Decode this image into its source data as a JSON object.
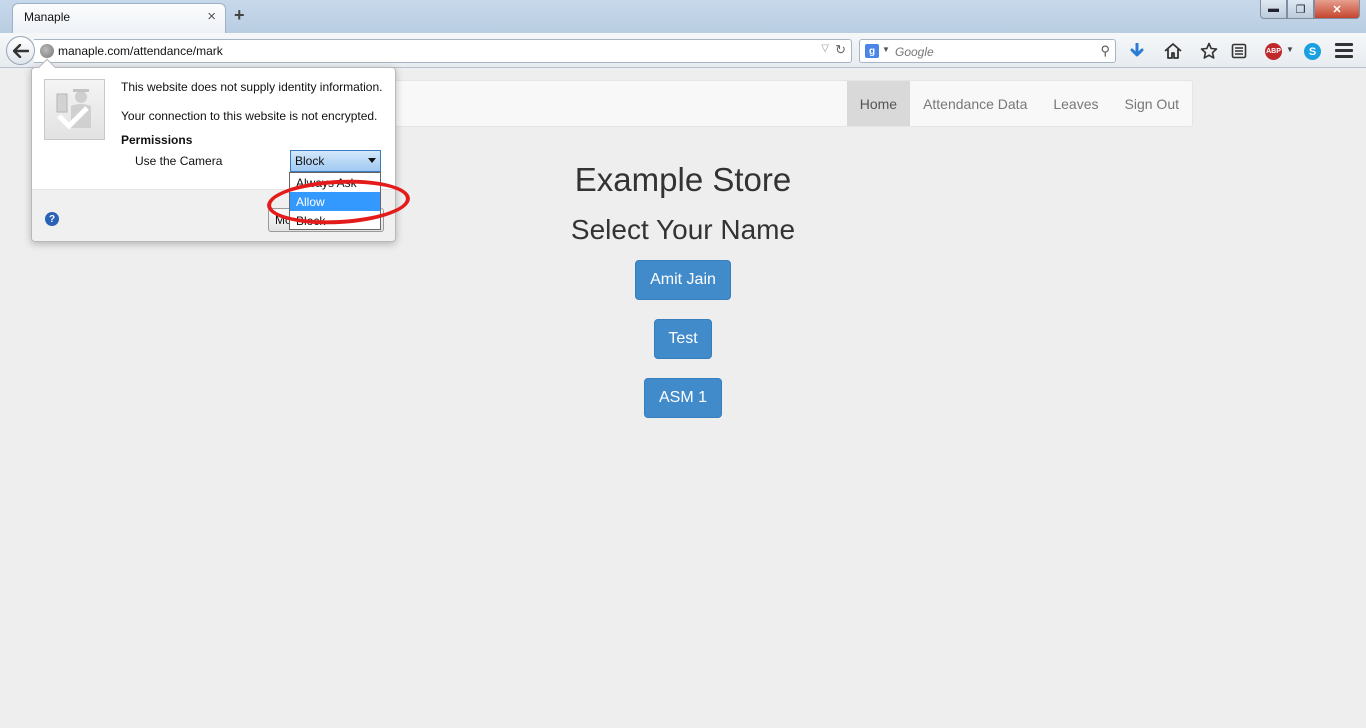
{
  "browser": {
    "tab_title": "Manaple",
    "tab_close": "×",
    "new_tab": "+",
    "url": "manaple.com/attendance/mark",
    "search_placeholder": "Google",
    "search_engine_letter": "g",
    "window_minimize": "▬",
    "window_restore": "❐",
    "window_close": "✕",
    "toolbar_icons": [
      "back-arrow-icon",
      "globe-icon",
      "url-dropdown-icon",
      "reload-icon",
      "google-icon",
      "search-icon",
      "download-icon",
      "home-icon",
      "bookmark-star-icon",
      "bookmarks-list-icon",
      "adblock-plus-icon",
      "skype-icon",
      "hamburger-menu-icon"
    ],
    "abp_label": "ABP",
    "skype_label": "S"
  },
  "site": {
    "nav": [
      {
        "label": "Home",
        "active": true
      },
      {
        "label": "Attendance Data",
        "active": false
      },
      {
        "label": "Leaves",
        "active": false
      },
      {
        "label": "Sign Out",
        "active": false
      }
    ],
    "store_title": "Example Store",
    "select_title": "Select Your Name",
    "names": [
      "Amit Jain",
      "Test",
      "ASM 1"
    ]
  },
  "identity_popup": {
    "line1": "This website does not supply identity information.",
    "line2": "Your connection to this website is not encrypted.",
    "permissions_heading": "Permissions",
    "permission_label": "Use the Camera",
    "permission_value": "Block",
    "more_button": "More Information...",
    "help_symbol": "?",
    "options": [
      {
        "label": "Always Ask",
        "selected": false
      },
      {
        "label": "Allow",
        "selected": true
      },
      {
        "label": "Block",
        "selected": false
      }
    ]
  },
  "colors": {
    "accent": "#428bca",
    "highlight": "#e41b1b",
    "selected_option": "#3399ff"
  }
}
